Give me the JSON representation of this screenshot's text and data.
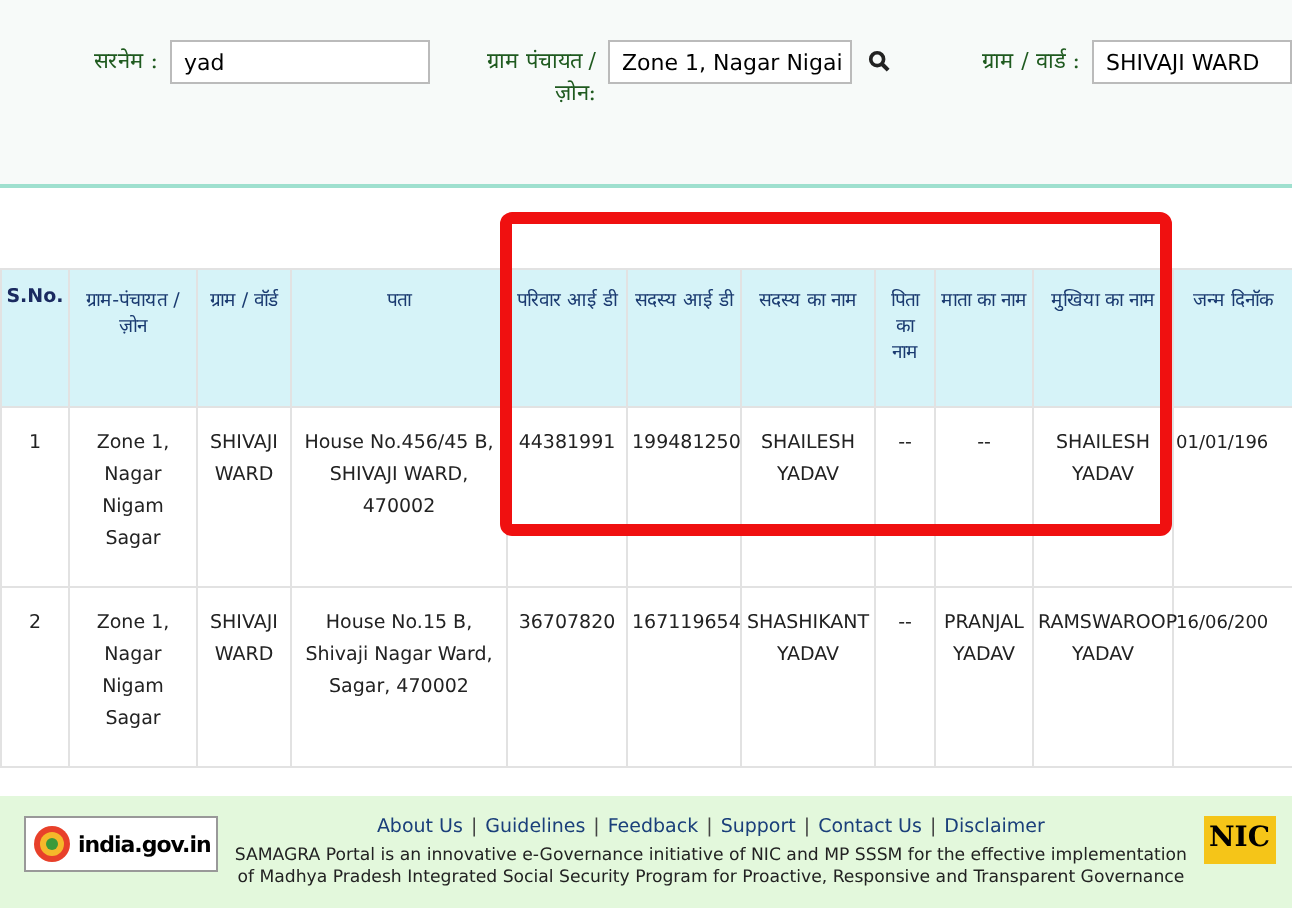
{
  "filters": [
    {
      "label": "सरनेम :",
      "kind": "text",
      "value": "yad"
    },
    {
      "label": "ग्राम पंचायत / ज़ोन:",
      "kind": "select",
      "value": "Zone 1, Nagar Nigai"
    },
    {
      "label": "ग्राम / वार्ड :",
      "kind": "text",
      "value": "SHIVAJI WARD"
    }
  ],
  "table": {
    "columns": [
      "S.No.",
      "ग्राम-पंचायत / ज़ोन",
      "ग्राम / वॉर्ड",
      "पता",
      "परिवार आई डी",
      "सदस्य आई डी",
      "सदस्य का नाम",
      "पिता का नाम",
      "माता का नाम",
      "मुखिया का नाम",
      "जन्म दिनॉक"
    ],
    "rows": [
      [
        "1",
        "Zone 1, Nagar Nigam Sagar",
        "SHIVAJI WARD",
        "House No.456/45 B, SHIVAJI WARD, 470002",
        "44381991",
        "199481250",
        "SHAILESH YADAV",
        "--",
        "--",
        "SHAILESH YADAV",
        "01/01/196"
      ],
      [
        "2",
        "Zone 1, Nagar Nigam Sagar",
        "SHIVAJI WARD",
        "House No.15 B, Shivaji Nagar Ward, Sagar, 470002",
        "36707820",
        "167119654",
        "SHASHIKANT YADAV",
        "--",
        "PRANJAL YADAV",
        "RAMSWAROOP YADAV",
        "16/06/200"
      ]
    ]
  },
  "footer": {
    "logo_text": "india.gov.in",
    "links": [
      "About Us",
      "Guidelines",
      "Feedback",
      "Support",
      "Contact Us",
      "Disclaimer"
    ],
    "separator": "|",
    "nic": "NIC",
    "description": "SAMAGRA Portal is an innovative e-Governance initiative of NIC and MP SSSM for the effective implementation of Madhya Pradesh Integrated Social Security Program for Proactive, Responsive and Transparent Governance"
  }
}
